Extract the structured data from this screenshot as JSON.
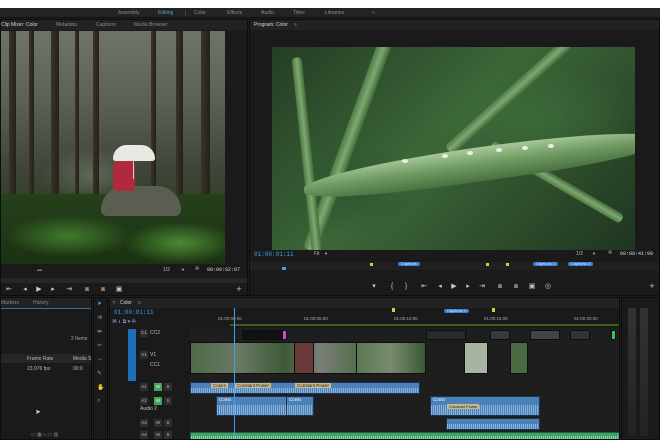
{
  "workspaces": [
    {
      "label": "Assembly",
      "active": false
    },
    {
      "label": "Editing",
      "active": true
    },
    {
      "label": "Color",
      "active": false
    },
    {
      "label": "Effects",
      "active": false
    },
    {
      "label": "Audio",
      "active": false
    },
    {
      "label": "Titles",
      "active": false
    },
    {
      "label": "Libraries",
      "active": false
    },
    {
      "label": "»",
      "active": false
    }
  ],
  "source_panel": {
    "tabs": [
      "Clip Mixer: Color",
      "Metadata",
      "Captions",
      "Media Browser"
    ],
    "zoom": "1/2",
    "timecode": "00:00:02:07"
  },
  "program_panel": {
    "tab": "Program: Color",
    "timecode_left": "01:00:01:11",
    "fit": "Fit",
    "zoom": "1/2",
    "timecode_right": "00:00:41:09",
    "markers": [
      "Captions",
      "Captions 1",
      "Captions 2"
    ]
  },
  "project_panel": {
    "tabs": [
      "Markers",
      "History"
    ],
    "item_count": "2 Items",
    "columns": [
      "Frame Rate",
      "Media S"
    ],
    "rows": [
      {
        "frame_rate": "23,976 fps",
        "media_start": "00:0"
      }
    ]
  },
  "timeline": {
    "tab": "Color",
    "timecode": "01:00:01:11",
    "ruler": [
      "01:00:00:00",
      "01:00:05:00",
      "01:00:10:00",
      "01:00:15:00",
      "01:00:20:00"
    ],
    "caption_marker": "Captions 1",
    "tracks": [
      "C1",
      "V1",
      "A1",
      "A2",
      "A3",
      "A4"
    ],
    "track_labels": {
      "cc1": "CC1",
      "v1": "V1",
      "cc2": "CC2",
      "audio2": "Audio 2"
    },
    "transitions": [
      "Constant Power",
      "Constant Power",
      "Constant Power"
    ],
    "clip_labels": [
      "Colors",
      "Const",
      "Const",
      "Const"
    ]
  }
}
